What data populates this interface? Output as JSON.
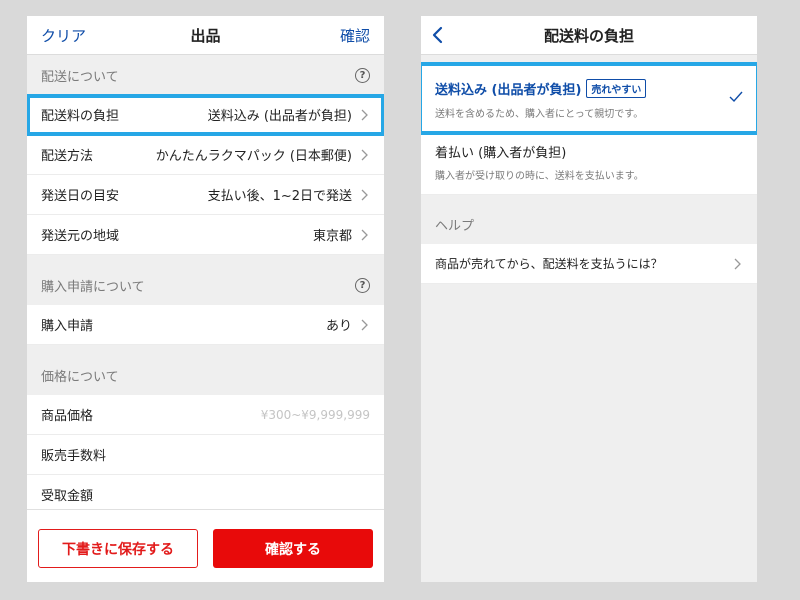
{
  "left": {
    "nav": {
      "clear": "クリア",
      "title": "出品",
      "confirm": "確認"
    },
    "shipping": {
      "header": "配送について",
      "rows": [
        {
          "label": "配送料の負担",
          "value": "送料込み (出品者が負担)"
        },
        {
          "label": "配送方法",
          "value": "かんたんラクマパック (日本郵便)"
        },
        {
          "label": "発送日の目安",
          "value": "支払い後、1~2日で発送"
        },
        {
          "label": "発送元の地域",
          "value": "東京都"
        }
      ]
    },
    "purchase": {
      "header": "購入申請について",
      "rows": [
        {
          "label": "購入申請",
          "value": "あり"
        }
      ]
    },
    "price": {
      "header": "価格について",
      "rows": [
        {
          "label": "商品価格",
          "placeholder": "¥300~¥9,999,999"
        },
        {
          "label": "販売手数料"
        },
        {
          "label": "受取金額"
        }
      ]
    },
    "buttons": {
      "draft": "下書きに保存する",
      "confirm": "確認する"
    }
  },
  "right": {
    "nav": {
      "title": "配送料の負担"
    },
    "options": [
      {
        "title": "送料込み (出品者が負担)",
        "badge": "売れやすい",
        "desc": "送料を含めるため、購入者にとって親切です。",
        "selected": true
      },
      {
        "title": "着払い (購入者が負担)",
        "desc": "購入者が受け取りの時に、送料を支払います。",
        "selected": false
      }
    ],
    "help": {
      "header": "ヘルプ",
      "item": "商品が売れてから、配送料を支払うには？"
    }
  },
  "colors": {
    "accent_blue": "#0f4da8",
    "red": "#e80a0a",
    "highlight": "#26a7e6"
  }
}
